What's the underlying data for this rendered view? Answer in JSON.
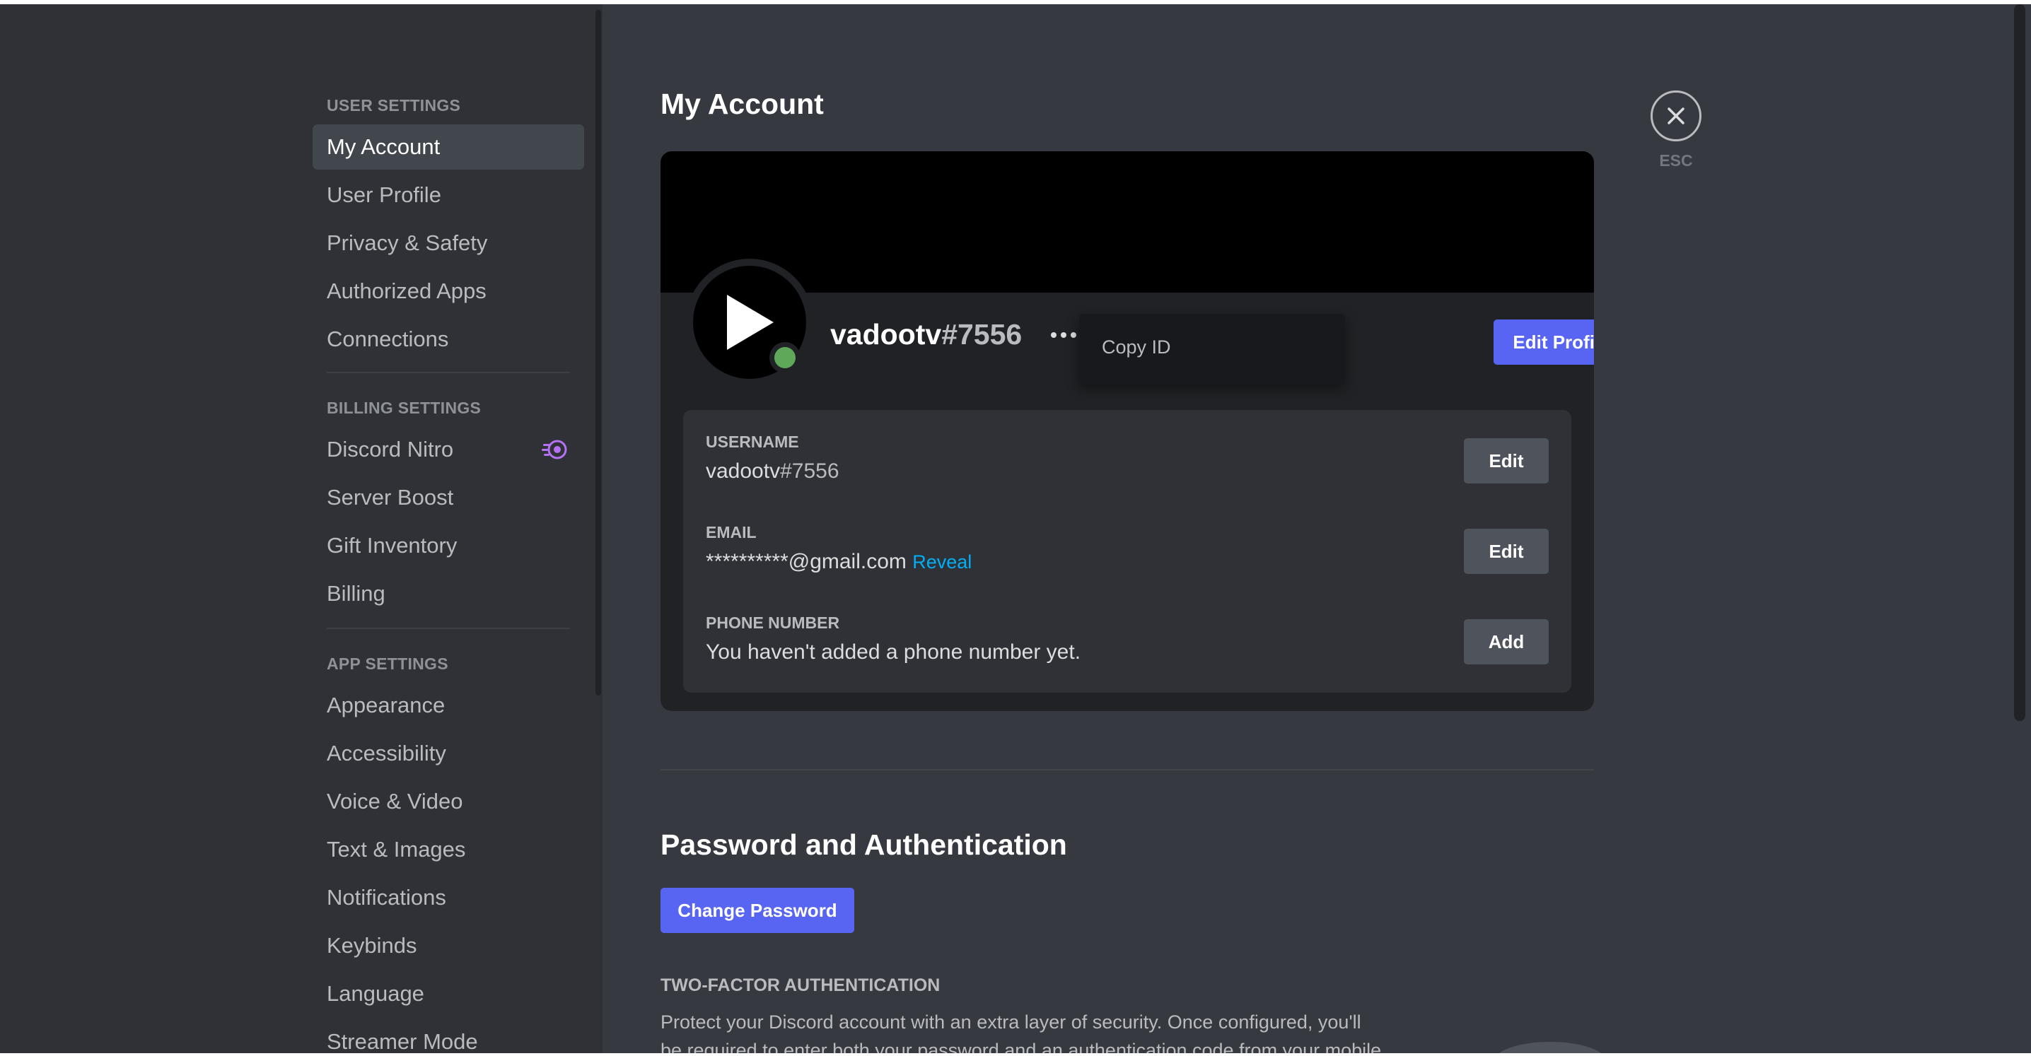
{
  "sidebar": {
    "user_settings_header": "USER SETTINGS",
    "user_items": [
      {
        "label": "My Account"
      },
      {
        "label": "User Profile"
      },
      {
        "label": "Privacy & Safety"
      },
      {
        "label": "Authorized Apps"
      },
      {
        "label": "Connections"
      }
    ],
    "billing_settings_header": "BILLING SETTINGS",
    "billing_items": [
      {
        "label": "Discord Nitro",
        "icon": "nitro-icon"
      },
      {
        "label": "Server Boost"
      },
      {
        "label": "Gift Inventory"
      },
      {
        "label": "Billing"
      }
    ],
    "app_settings_header": "APP SETTINGS",
    "app_items": [
      {
        "label": "Appearance"
      },
      {
        "label": "Accessibility"
      },
      {
        "label": "Voice & Video"
      },
      {
        "label": "Text & Images"
      },
      {
        "label": "Notifications"
      },
      {
        "label": "Keybinds"
      },
      {
        "label": "Language"
      },
      {
        "label": "Streamer Mode"
      }
    ],
    "active_item": "My Account"
  },
  "main": {
    "title": "My Account",
    "close": {
      "label": "ESC",
      "icon": "close-icon"
    },
    "profile": {
      "username": "vadootv",
      "discriminator": "#7556",
      "avatar_icon": "play-icon",
      "status": "online",
      "status_color": "#5fa85a",
      "more_icon": "ellipsis-icon",
      "edit_profile_label": "Edit Profile"
    },
    "context_menu": {
      "copy_id_label": "Copy ID"
    },
    "fields": {
      "username": {
        "label": "USERNAME",
        "value_name": "vadootv",
        "value_tag": "#7556",
        "button": "Edit"
      },
      "email": {
        "label": "EMAIL",
        "value": "**********@gmail.com",
        "reveal_label": "Reveal",
        "button": "Edit"
      },
      "phone": {
        "label": "PHONE NUMBER",
        "value": "You haven't added a phone number yet.",
        "button": "Add"
      }
    },
    "password_section": {
      "heading": "Password and Authentication",
      "change_password_label": "Change Password",
      "tfa_label": "TWO-FACTOR AUTHENTICATION",
      "tfa_description": "Protect your Discord account with an extra layer of security. Once configured, you'll be required to enter both your password and an authentication code from your mobile"
    }
  },
  "colors": {
    "accent": "#5865f2",
    "link": "#00aff4",
    "sidebar_bg": "#2f3136",
    "content_bg": "#36393f",
    "card_bg": "#202225"
  }
}
